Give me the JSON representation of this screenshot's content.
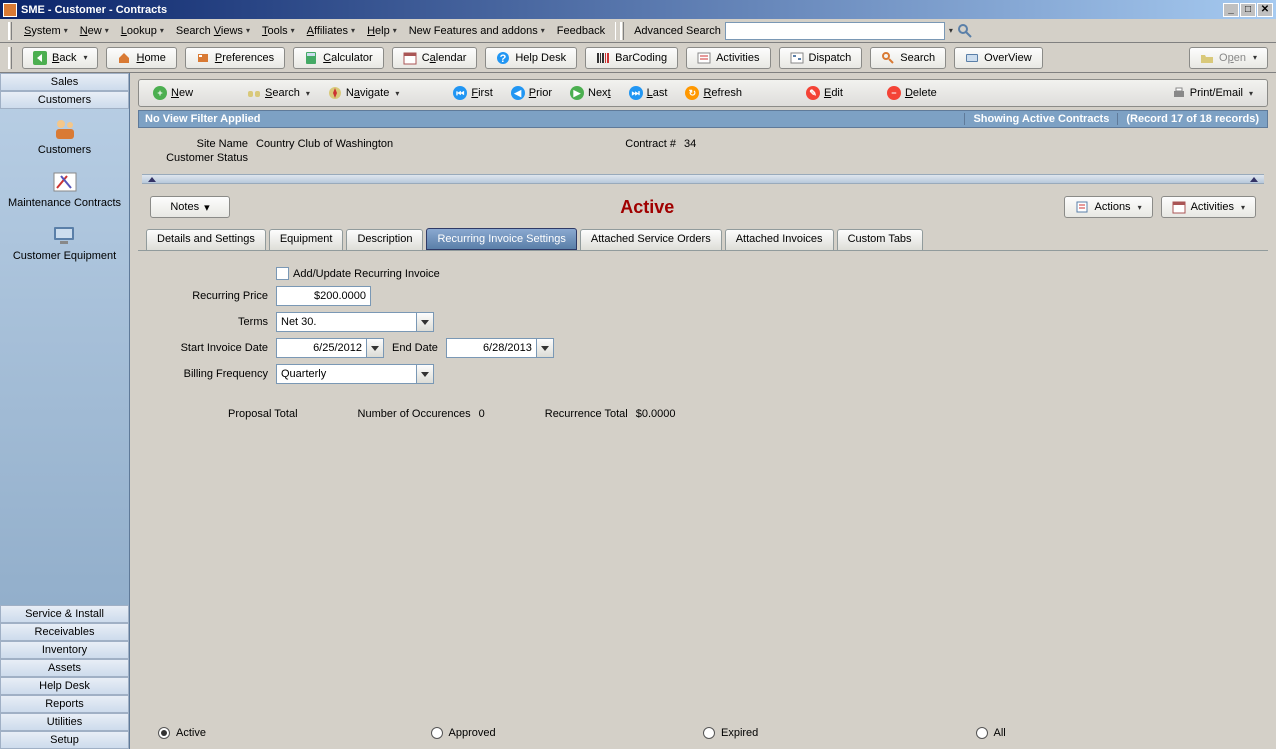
{
  "window": {
    "title": "SME - Customer - Contracts"
  },
  "menus": {
    "system": "System",
    "new": "New",
    "lookup": "Lookup",
    "searchviews": "Search Views",
    "tools": "Tools",
    "affiliates": "Affiliates",
    "help": "Help",
    "features": "New Features and addons",
    "feedback": "Feedback",
    "advsearch": "Advanced Search"
  },
  "toolbar": {
    "back": "Back",
    "home": "Home",
    "preferences": "Preferences",
    "calculator": "Calculator",
    "calendar": "Calendar",
    "helpdesk": "Help Desk",
    "barcoding": "BarCoding",
    "activities": "Activities",
    "dispatch": "Dispatch",
    "search": "Search",
    "overview": "OverView",
    "open": "Open"
  },
  "rec": {
    "new": "New",
    "search": "Search",
    "navigate": "Navigate",
    "first": "First",
    "prior": "Prior",
    "next": "Next",
    "last": "Last",
    "refresh": "Refresh",
    "edit": "Edit",
    "delete": "Delete",
    "printemail": "Print/Email"
  },
  "status": {
    "filter": "No View Filter Applied",
    "showing": "Showing Active Contracts",
    "record": "(Record 17 of 18 records)"
  },
  "header": {
    "site_label": "Site Name",
    "site_value": "Country Club of Washington",
    "custstatus_label": "Customer Status",
    "contract_label": "Contract #",
    "contract_value": "34"
  },
  "sidebar": {
    "sales": "Sales",
    "customers_top": "Customers",
    "customers": "Customers",
    "maint": "Maintenance Contracts",
    "equip": "Customer Equipment",
    "footer": [
      "Service & Install",
      "Receivables",
      "Inventory",
      "Assets",
      "Help Desk",
      "Reports",
      "Utilities",
      "Setup"
    ]
  },
  "actions": {
    "notes": "Notes",
    "status": "Active",
    "actions": "Actions",
    "activities": "Activities"
  },
  "tabs": [
    "Details and Settings",
    "Equipment",
    "Description",
    "Recurring Invoice Settings",
    "Attached Service Orders",
    "Attached Invoices",
    "Custom Tabs"
  ],
  "form": {
    "addupdate": "Add/Update Recurring Invoice",
    "price_label": "Recurring Price",
    "price": "$200.0000",
    "terms_label": "Terms",
    "terms": "Net 30.",
    "start_label": "Start Invoice Date",
    "start": "6/25/2012",
    "end_label": "End Date",
    "end": "6/28/2013",
    "freq_label": "Billing Frequency",
    "freq": "Quarterly",
    "proposal_label": "Proposal Total",
    "occur_label": "Number of Occurences",
    "occur": "0",
    "rectotal_label": "Recurrence Total",
    "rectotal": "$0.0000"
  },
  "radios": {
    "active": "Active",
    "approved": "Approved",
    "expired": "Expired",
    "all": "All"
  }
}
